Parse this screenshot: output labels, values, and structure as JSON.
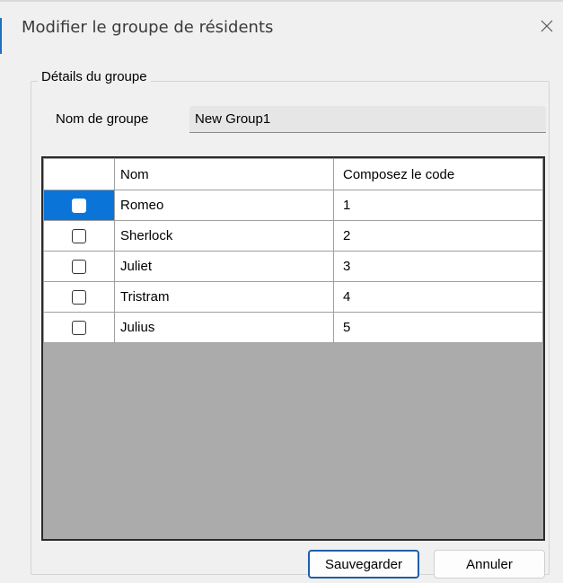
{
  "window": {
    "title": "Modifier le groupe de résidents",
    "close_icon": "close-icon"
  },
  "group_details": {
    "legend": "Détails du groupe",
    "name_label": "Nom de groupe",
    "name_value": "New Group1"
  },
  "table": {
    "columns": [
      "",
      "Nom",
      "Composez le code"
    ],
    "rows": [
      {
        "checked": false,
        "name": "Romeo",
        "code": "1",
        "selected": true
      },
      {
        "checked": false,
        "name": "Sherlock",
        "code": "2",
        "selected": false
      },
      {
        "checked": false,
        "name": "Juliet",
        "code": "3",
        "selected": false
      },
      {
        "checked": false,
        "name": "Tristram",
        "code": "4",
        "selected": false
      },
      {
        "checked": false,
        "name": "Julius",
        "code": "5",
        "selected": false
      }
    ]
  },
  "buttons": {
    "save": "Sauvegarder",
    "cancel": "Annuler"
  },
  "colors": {
    "selection": "#0a74d8",
    "grid_background": "#ababab",
    "default_button_border": "#1f5fa8"
  }
}
